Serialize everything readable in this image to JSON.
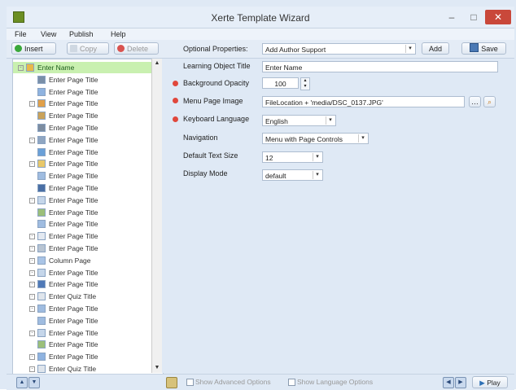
{
  "window": {
    "title": "Xerte Template Wizard",
    "controls": {
      "minimize": "–",
      "maximize": "□",
      "close": "✕"
    }
  },
  "menu": [
    "File",
    "View",
    "Publish",
    "Help"
  ],
  "toolbar": {
    "insert": "Insert",
    "copy": "Copy",
    "delete": "Delete"
  },
  "tree": {
    "items": [
      {
        "label": "Enter Name",
        "expander": "⊟",
        "icon": "home-icon",
        "selected": true
      },
      {
        "label": "Enter Page Title",
        "expander": "",
        "icon": "audio-icon"
      },
      {
        "label": "Enter Page Title",
        "expander": "",
        "icon": "speech-bubble-icon"
      },
      {
        "label": "Enter Page Title",
        "expander": "⊞",
        "icon": "image-text-icon"
      },
      {
        "label": "Enter Page Title",
        "expander": "",
        "icon": "image-icon"
      },
      {
        "label": "Enter Page Title",
        "expander": "",
        "icon": "grid-icon"
      },
      {
        "label": "Enter Page Title",
        "expander": "⊞",
        "icon": "magnifier-icon"
      },
      {
        "label": "Enter Page Title",
        "expander": "",
        "icon": "crop-icon"
      },
      {
        "label": "Enter Page Title",
        "expander": "⊞",
        "icon": "pointer-icon"
      },
      {
        "label": "Enter Page Title",
        "expander": "",
        "icon": "page-icon"
      },
      {
        "label": "Enter Page Title",
        "expander": "",
        "icon": "bars-icon"
      },
      {
        "label": "Enter Page Title",
        "expander": "⊞",
        "icon": "window-icon"
      },
      {
        "label": "Enter Page Title",
        "expander": "",
        "icon": "media-icon"
      },
      {
        "label": "Enter Page Title",
        "expander": "",
        "icon": "page-icon"
      },
      {
        "label": "Enter Page Title",
        "expander": "⊞",
        "icon": "document-icon"
      },
      {
        "label": "Enter Page Title",
        "expander": "⊞",
        "icon": "line-icon"
      },
      {
        "label": "Column Page",
        "expander": "⊞",
        "icon": "columns-icon"
      },
      {
        "label": "Enter Page Title",
        "expander": "⊞",
        "icon": "window-icon"
      },
      {
        "label": "Enter Page Title",
        "expander": "⊞",
        "icon": "form-icon"
      },
      {
        "label": "Enter Quiz Title",
        "expander": "⊞",
        "icon": "quiz-icon"
      },
      {
        "label": "Enter Page Title",
        "expander": "⊞",
        "icon": "page-icon"
      },
      {
        "label": "Enter Page Title",
        "expander": "",
        "icon": "page-icon"
      },
      {
        "label": "Enter Page Title",
        "expander": "⊞",
        "icon": "window-icon"
      },
      {
        "label": "Enter Page Title",
        "expander": "",
        "icon": "media-icon"
      },
      {
        "label": "Enter Page Title",
        "expander": "⊞",
        "icon": "speech-bubble-icon"
      },
      {
        "label": "Enter Quiz Title",
        "expander": "⊞",
        "icon": "quiz-icon"
      }
    ]
  },
  "properties": {
    "optional_label": "Optional Properties:",
    "optional_select": "Add Author Support",
    "add_button": "Add",
    "save_button": "Save",
    "title_label": "Learning Object Title",
    "title_value": "Enter Name",
    "opacity_label": "Background Opacity",
    "opacity_value": "100",
    "menu_image_label": "Menu Page Image",
    "menu_image_value": "FileLocation + 'media/DSC_0137.JPG'",
    "keyboard_label": "Keyboard Language",
    "keyboard_value": "English",
    "navigation_label": "Navigation",
    "navigation_value": "Menu with Page Controls",
    "text_size_label": "Default Text Size",
    "text_size_value": "12",
    "display_mode_label": "Display Mode",
    "display_mode_value": "default"
  },
  "bottom": {
    "advanced_options": "Show Advanced Options",
    "language_options": "Show Language Options",
    "play_button": "Play"
  }
}
